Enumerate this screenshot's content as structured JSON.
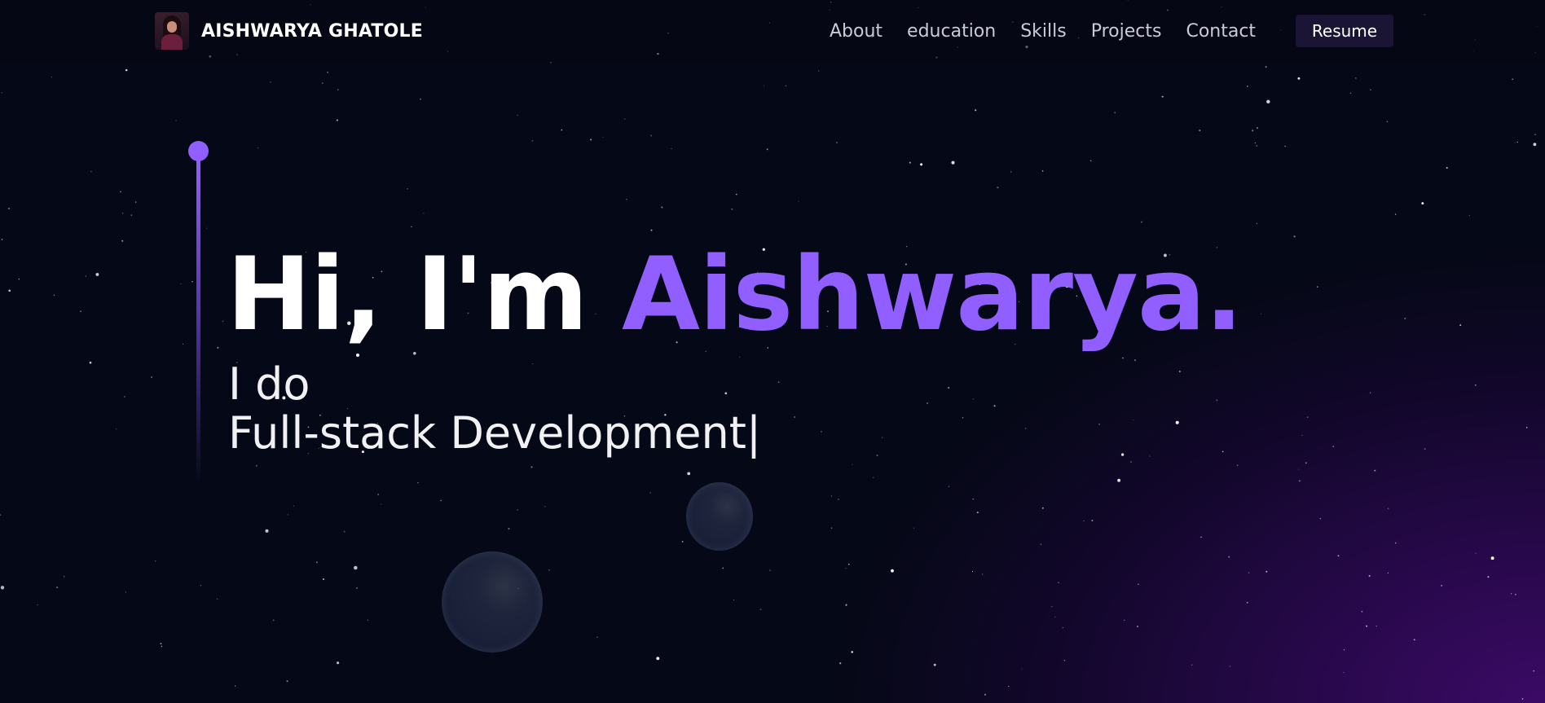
{
  "brand": {
    "name": "AISHWARYA GHATOLE"
  },
  "nav": {
    "links": [
      "About",
      "education",
      "Skills",
      "Projects",
      "Contact"
    ],
    "resume_label": "Resume"
  },
  "hero": {
    "greeting": "Hi, I'm",
    "name": "Aishwarya.",
    "line1": "I do",
    "line2": "Full-stack Development",
    "cursor": "|"
  },
  "colors": {
    "accent": "#915eff",
    "background": "#050816",
    "glow": "#3b0a66",
    "resume_button_bg": "#1b1535"
  },
  "icons": [
    "avatar-photo"
  ]
}
